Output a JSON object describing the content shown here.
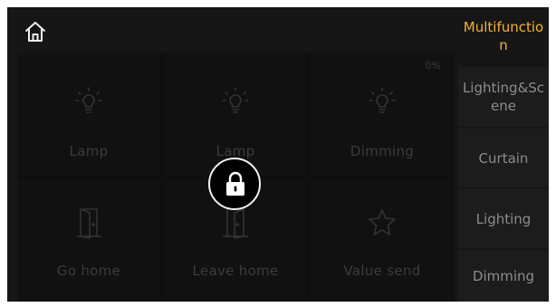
{
  "header": {
    "home_icon": "home-icon"
  },
  "grid": {
    "percent": "0%",
    "tiles": [
      {
        "label": "Lamp",
        "icon": "bulb-icon"
      },
      {
        "label": "Lamp",
        "icon": "bulb-icon"
      },
      {
        "label": "Dimming",
        "icon": "bulb-icon"
      },
      {
        "label": "Go home",
        "icon": "door-icon"
      },
      {
        "label": "Leave home",
        "icon": "door-icon"
      },
      {
        "label": "Value send",
        "icon": "star-icon"
      }
    ],
    "lock_icon": "lock-icon"
  },
  "sidebar": {
    "items": [
      {
        "label": "Multifunction"
      },
      {
        "label": "Lighting&Scene"
      },
      {
        "label": "Curtain"
      },
      {
        "label": "Lighting"
      },
      {
        "label": "Dimming"
      }
    ]
  },
  "colors": {
    "accent": "#f2b233",
    "background": "#161616",
    "inactive_text": "#8c8c8c"
  }
}
